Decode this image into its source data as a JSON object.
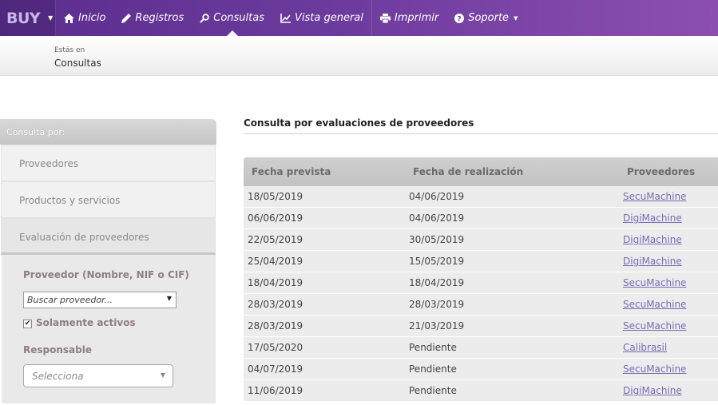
{
  "nav": {
    "brand": "BUY",
    "items": [
      {
        "label": "Inicio",
        "icon": "home-icon"
      },
      {
        "label": "Registros",
        "icon": "pencil-icon"
      },
      {
        "label": "Consultas",
        "icon": "search-icon"
      },
      {
        "label": "Vista general",
        "icon": "chart-line-icon"
      },
      {
        "label": "Imprimir",
        "icon": "printer-icon"
      },
      {
        "label": "Soporte",
        "icon": "help-circle-icon"
      }
    ],
    "active": "Consultas",
    "colors": {
      "gradient_start": "#5b2d8e",
      "gradient_end": "#8c4fb0"
    }
  },
  "breadcrumb": {
    "prefix": "Estás en",
    "current": "Consultas"
  },
  "sidebar": {
    "header": "Consulta por:",
    "items": [
      {
        "label": "Proveedores"
      },
      {
        "label": "Productos y servicios"
      },
      {
        "label": "Evaluación de proveedores"
      }
    ],
    "filters": {
      "provider_label": "Proveedor (Nombre, NIF o CIF)",
      "provider_placeholder": "Buscar proveedor...",
      "only_active_label": "Solamente activos",
      "only_active_checked": true,
      "responsible_label": "Responsable",
      "responsible_placeholder": "Selecciona"
    }
  },
  "main": {
    "title": "Consulta por evaluaciones de proveedores",
    "columns": [
      "Fecha prevista",
      "Fecha de realización",
      "Proveedores"
    ],
    "rows": [
      {
        "planned": "18/05/2019",
        "done": "04/06/2019",
        "provider": "SecuMachine"
      },
      {
        "planned": "06/06/2019",
        "done": "04/06/2019",
        "provider": "DigiMachine"
      },
      {
        "planned": "22/05/2019",
        "done": "30/05/2019",
        "provider": "DigiMachine"
      },
      {
        "planned": "25/04/2019",
        "done": "15/05/2019",
        "provider": "DigiMachine"
      },
      {
        "planned": "18/04/2019",
        "done": "18/04/2019",
        "provider": "SecuMachine"
      },
      {
        "planned": "28/03/2019",
        "done": "28/03/2019",
        "provider": "SecuMachine"
      },
      {
        "planned": "28/03/2019",
        "done": "21/03/2019",
        "provider": "SecuMachine"
      },
      {
        "planned": "17/05/2020",
        "done": "Pendiente",
        "provider": "Calibrasil"
      },
      {
        "planned": "04/07/2019",
        "done": "Pendiente",
        "provider": "SecuMachine"
      },
      {
        "planned": "11/06/2019",
        "done": "Pendiente",
        "provider": "DigiMachine"
      }
    ]
  }
}
